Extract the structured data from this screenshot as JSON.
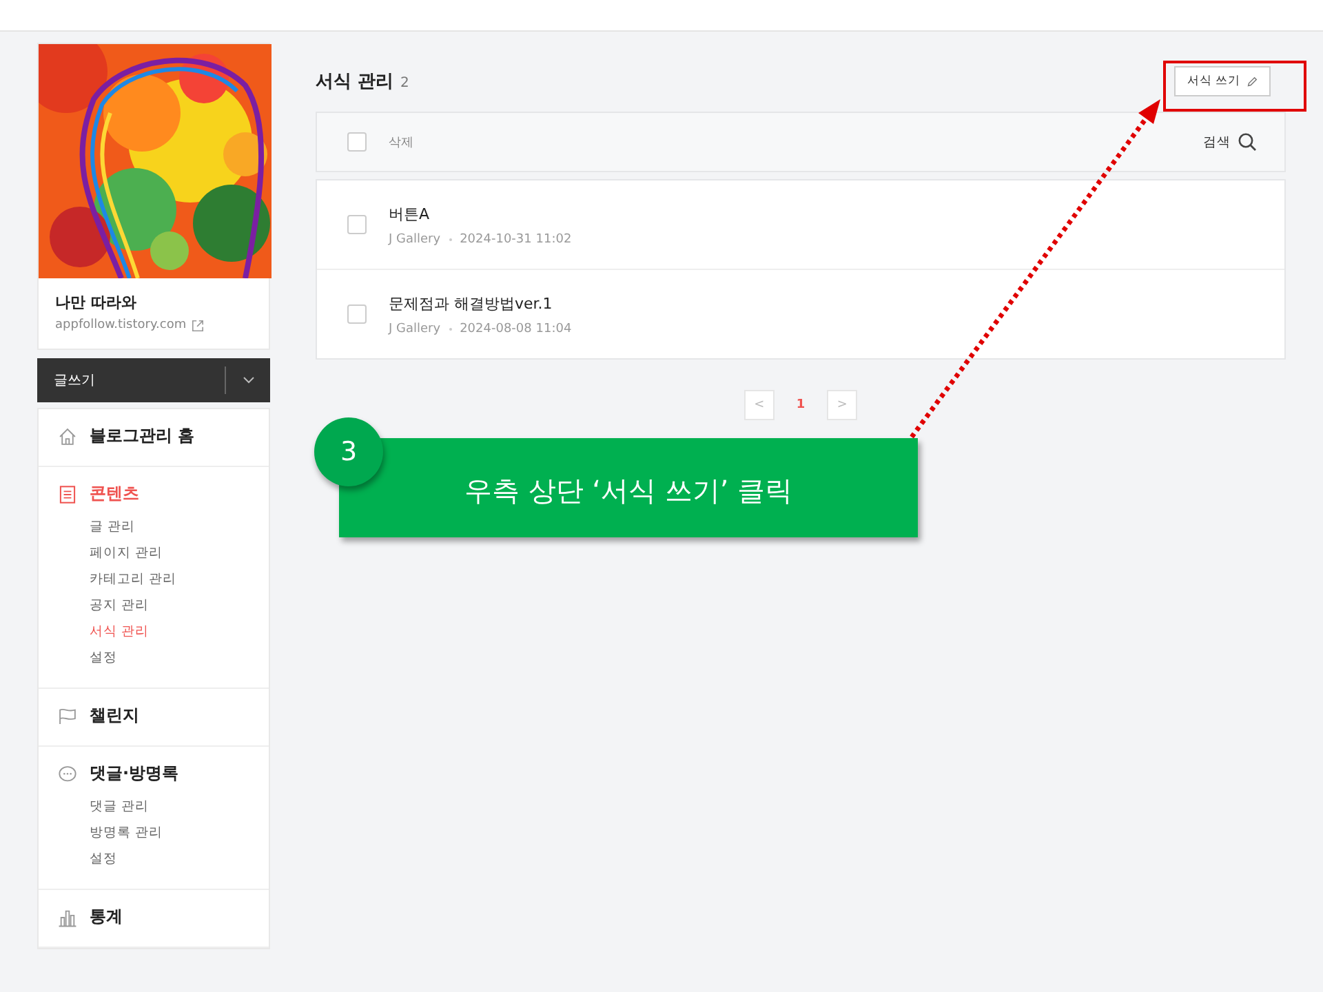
{
  "sidebar": {
    "blog_name": "나만 따라와",
    "blog_url": "appfollow.tistory.com",
    "write_button": "글쓰기",
    "menu": [
      {
        "kind": "home",
        "label": "블로그관리 홈",
        "selected": false
      },
      {
        "kind": "document",
        "label": "콘텐츠",
        "selected": true,
        "children": [
          {
            "label": "글 관리",
            "selected": false
          },
          {
            "label": "페이지 관리",
            "selected": false
          },
          {
            "label": "카테고리 관리",
            "selected": false
          },
          {
            "label": "공지 관리",
            "selected": false
          },
          {
            "label": "서식 관리",
            "selected": true
          },
          {
            "label": "설정",
            "selected": false
          }
        ]
      },
      {
        "kind": "flag",
        "label": "챌린지",
        "selected": false
      },
      {
        "kind": "chat",
        "label": "댓글·방명록",
        "selected": false,
        "children": [
          {
            "label": "댓글 관리",
            "selected": false
          },
          {
            "label": "방명록 관리",
            "selected": false
          },
          {
            "label": "설정",
            "selected": false
          }
        ]
      },
      {
        "kind": "chart",
        "label": "통계",
        "selected": false
      }
    ]
  },
  "main": {
    "title": "서식 관리",
    "count": "2",
    "write_button": "서식 쓰기",
    "toolbar": {
      "select_all_checked": false,
      "delete": "삭제",
      "search": "검색"
    },
    "rows": [
      {
        "title": "버튼A",
        "author": "J Gallery",
        "date": "2024-10-31 11:02",
        "checked": false
      },
      {
        "title": "문제점과 해결방법ver.1",
        "author": "J Gallery",
        "date": "2024-08-08 11:04",
        "checked": false
      }
    ],
    "pagination": {
      "prev": "<",
      "next": ">",
      "pages": [
        {
          "label": "1",
          "selected": true
        }
      ]
    }
  },
  "annotation": {
    "step": "3",
    "text": "우측 상단 ‘서식 쓰기’ 클릭"
  }
}
